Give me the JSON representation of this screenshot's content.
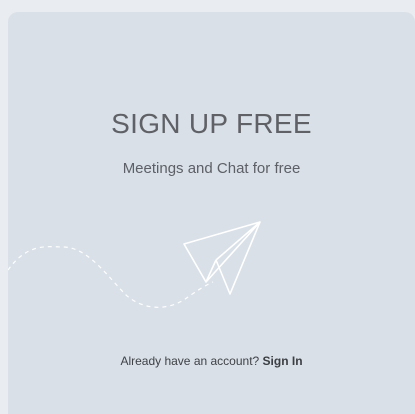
{
  "signup": {
    "title": "SIGN UP FREE",
    "subtitle": "Meetings and Chat for free",
    "footer_text": "Already have an account?",
    "signin_label": "Sign In"
  },
  "illustration": {
    "icon": "paper-plane-icon"
  },
  "colors": {
    "background": "#e9ecf0",
    "card": "#d9e0e8",
    "text": "#5f6166",
    "line": "#ffffff"
  }
}
